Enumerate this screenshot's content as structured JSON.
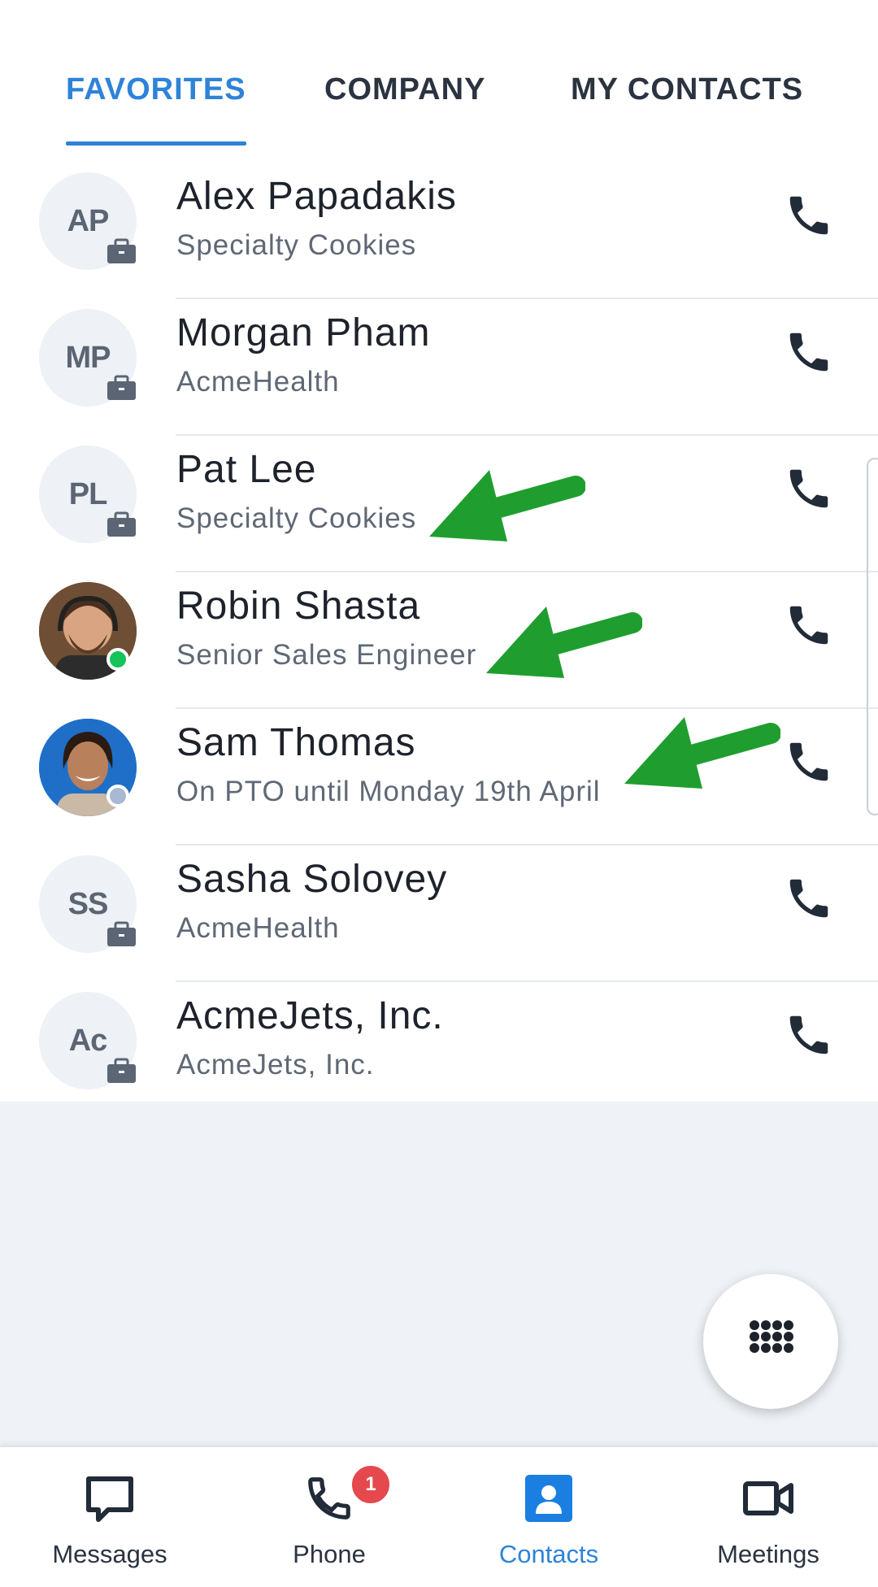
{
  "tabs": [
    {
      "label": "FAVORITES",
      "active": true
    },
    {
      "label": "COMPANY",
      "active": false
    },
    {
      "label": "MY CONTACTS",
      "active": false
    }
  ],
  "contacts": [
    {
      "initials": "AP",
      "name": "Alex Papadakis",
      "subtitle": "Specialty Cookies",
      "type": "company-contact"
    },
    {
      "initials": "MP",
      "name": "Morgan Pham",
      "subtitle": "AcmeHealth",
      "type": "company-contact"
    },
    {
      "initials": "PL",
      "name": "Pat Lee",
      "subtitle": "Specialty Cookies",
      "type": "company-contact"
    },
    {
      "initials": "",
      "name": "Robin Shasta",
      "subtitle": "Senior Sales Engineer",
      "type": "photo",
      "presence": "available"
    },
    {
      "initials": "",
      "name": "Sam Thomas",
      "subtitle": "On PTO until Monday 19th April",
      "type": "photo",
      "presence": "away"
    },
    {
      "initials": "SS",
      "name": "Sasha Solovey",
      "subtitle": "AcmeHealth",
      "type": "company-contact"
    },
    {
      "initials": "Ac",
      "name": "AcmeJets, Inc.",
      "subtitle": "AcmeJets, Inc.",
      "type": "company-contact"
    }
  ],
  "icons": {
    "call": "phone-icon",
    "briefcase": "briefcase-icon",
    "dialpad": "dialpad-icon",
    "annotation": "green-arrow"
  },
  "nav": [
    {
      "label": "Messages",
      "icon": "chat-icon",
      "active": false
    },
    {
      "label": "Phone",
      "icon": "phone-icon",
      "active": false,
      "badge": "1"
    },
    {
      "label": "Contacts",
      "icon": "contacts-icon",
      "active": true
    },
    {
      "label": "Meetings",
      "icon": "video-icon",
      "active": false
    }
  ],
  "colors": {
    "accent": "#2e83d9",
    "available": "#16c25a",
    "away": "#a9b8d3",
    "annotation_arrow": "#1f9e2f",
    "badge": "#e5484d"
  }
}
